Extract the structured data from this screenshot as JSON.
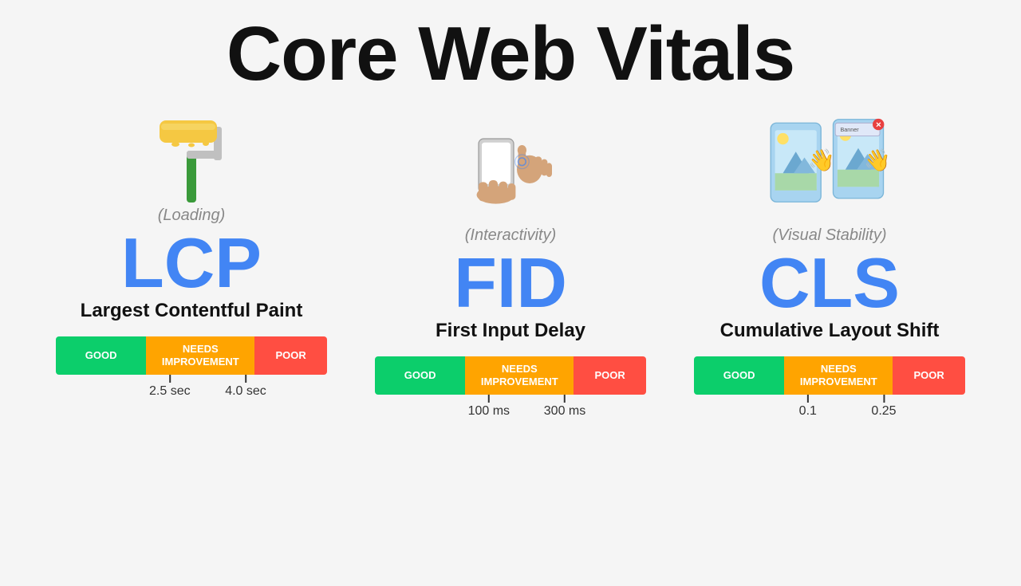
{
  "page": {
    "title": "Core Web Vitals",
    "background": "#f5f5f5"
  },
  "vitals": [
    {
      "id": "lcp",
      "category": "(Loading)",
      "abbr": "LCP",
      "name": "Largest Contentful Paint",
      "scale": {
        "good": "GOOD",
        "needs": "NEEDS IMPROVEMENT",
        "poor": "POOR",
        "tick1": "2.5 sec",
        "tick2": "4.0 sec",
        "tick1_pos": "42",
        "tick2_pos": "70"
      }
    },
    {
      "id": "fid",
      "category": "(Interactivity)",
      "abbr": "FID",
      "name": "First Input Delay",
      "scale": {
        "good": "GOOD",
        "needs": "NEEDS IMPROVEMENT",
        "poor": "POOR",
        "tick1": "100 ms",
        "tick2": "300 ms",
        "tick1_pos": "42",
        "tick2_pos": "70"
      }
    },
    {
      "id": "cls",
      "category": "(Visual Stability)",
      "abbr": "CLS",
      "name": "Cumulative Layout Shift",
      "scale": {
        "good": "GOOD",
        "needs": "NEEDS IMPROVEMENT",
        "poor": "POOR",
        "tick1": "0.1",
        "tick2": "0.25",
        "tick1_pos": "42",
        "tick2_pos": "70"
      }
    }
  ]
}
